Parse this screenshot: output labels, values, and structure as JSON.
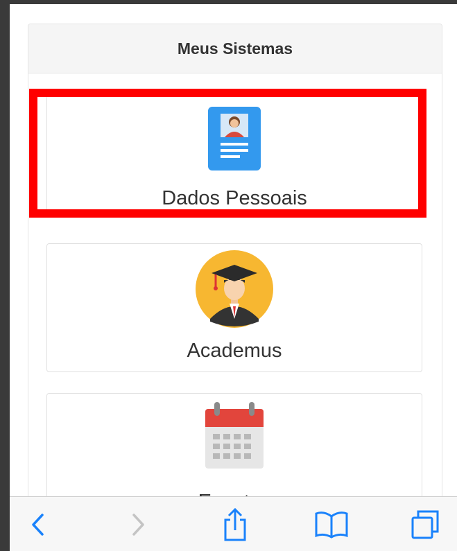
{
  "panel": {
    "title": "Meus Sistemas"
  },
  "cards": [
    {
      "label": "Dados Pessoais",
      "icon": "id-card-icon"
    },
    {
      "label": "Academus",
      "icon": "graduate-icon"
    },
    {
      "label": "Eventos",
      "icon": "calendar-icon"
    }
  ],
  "toolbar": {
    "back": "back-chevron-icon",
    "forward": "forward-chevron-icon",
    "share": "share-icon",
    "bookmarks": "bookmarks-book-icon",
    "tabs": "tabs-icon"
  },
  "colors": {
    "accent": "#1a82fb",
    "highlight": "#ff0000",
    "card_blue": "#3399ee",
    "avatar_yellow": "#f7b731",
    "calendar_red": "#e2453c"
  }
}
